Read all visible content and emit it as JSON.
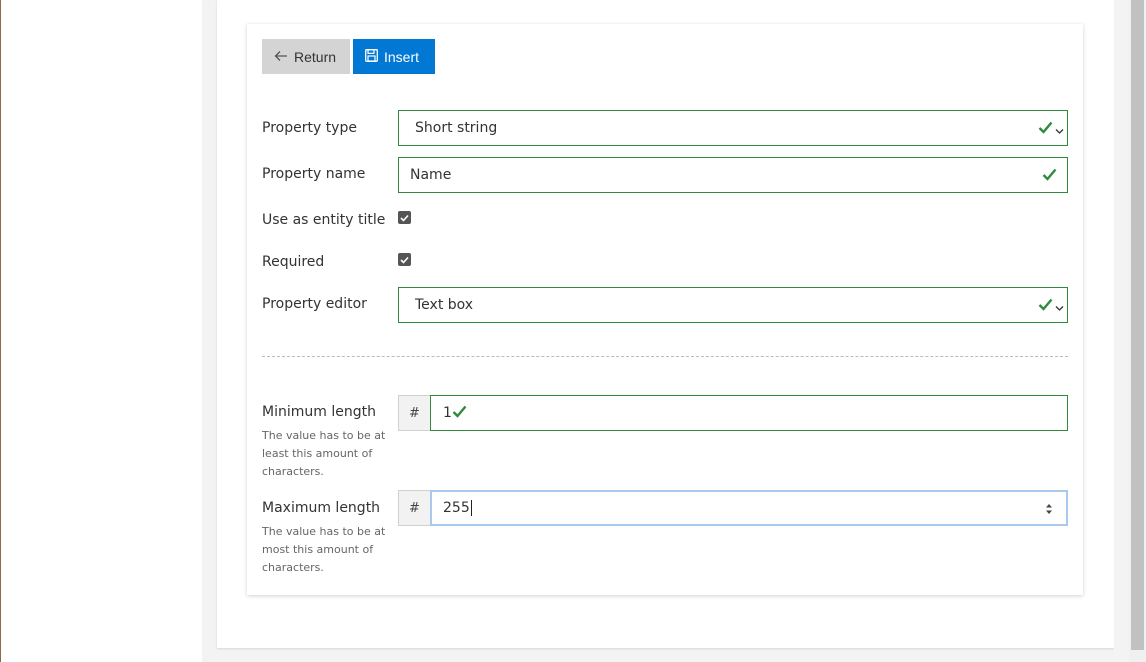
{
  "toolbar": {
    "return_label": "Return",
    "insert_label": "Insert"
  },
  "form": {
    "property_type": {
      "label": "Property type",
      "value": "Short string"
    },
    "property_name": {
      "label": "Property name",
      "value": "Name"
    },
    "use_as_title": {
      "label": "Use as entity title",
      "checked": true
    },
    "required": {
      "label": "Required",
      "checked": true
    },
    "property_editor": {
      "label": "Property editor",
      "value": "Text box"
    },
    "min_length": {
      "label": "Minimum length",
      "help": "The value has to be at least this amount of characters.",
      "addon": "#",
      "value": "1"
    },
    "max_length": {
      "label": "Maximum length",
      "help": "The value has to be at most this amount of characters.",
      "addon": "#",
      "value": "255"
    }
  },
  "colors": {
    "primary": "#0078d4",
    "valid": "#2e8b3e",
    "focus": "#a9c9ef",
    "secondary_button": "#d4d4d4"
  },
  "icons": {
    "return": "arrow-left-icon",
    "insert": "save-icon",
    "valid": "checkmark-icon"
  }
}
